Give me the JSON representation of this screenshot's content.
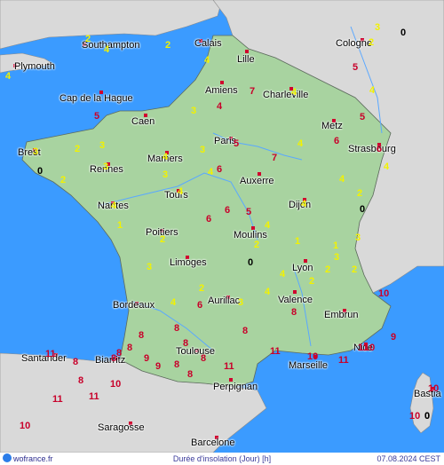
{
  "footer": {
    "brand": "wofrance.fr",
    "title": "Durée d'insolation (Jour) [h]",
    "date": "07.08.2024 CEST"
  },
  "cities": [
    {
      "name": "Southampton"
    },
    {
      "name": "Calais"
    },
    {
      "name": "Cologne"
    },
    {
      "name": "Plymouth"
    },
    {
      "name": "Lille"
    },
    {
      "name": "Cap de la Hague"
    },
    {
      "name": "Amiens"
    },
    {
      "name": "Charleville"
    },
    {
      "name": "Caen"
    },
    {
      "name": "Metz"
    },
    {
      "name": "Brest"
    },
    {
      "name": "Paris"
    },
    {
      "name": "Strasbourg"
    },
    {
      "name": "Mamers"
    },
    {
      "name": "Rennes"
    },
    {
      "name": "Auxerre"
    },
    {
      "name": "Tours"
    },
    {
      "name": "Nantes"
    },
    {
      "name": "Dijon"
    },
    {
      "name": "Poitiers"
    },
    {
      "name": "Moulins"
    },
    {
      "name": "Limoges"
    },
    {
      "name": "Lyon"
    },
    {
      "name": "Aurillac"
    },
    {
      "name": "Bordeaux"
    },
    {
      "name": "Valence"
    },
    {
      "name": "Embrun"
    },
    {
      "name": "Toulouse"
    },
    {
      "name": "Santander"
    },
    {
      "name": "Biarritz"
    },
    {
      "name": "Nice"
    },
    {
      "name": "Marseille"
    },
    {
      "name": "Perpignan"
    },
    {
      "name": "Bastia"
    },
    {
      "name": "Saragosse"
    },
    {
      "name": "Barcelone"
    }
  ],
  "values": [
    {
      "v": "2"
    },
    {
      "v": "4"
    },
    {
      "v": "2"
    },
    {
      "v": "4"
    },
    {
      "v": "4"
    },
    {
      "v": "0"
    },
    {
      "v": "2"
    },
    {
      "v": "7"
    },
    {
      "v": "4"
    },
    {
      "v": "3"
    },
    {
      "v": "4"
    },
    {
      "v": "5"
    },
    {
      "v": "4"
    },
    {
      "v": "5"
    },
    {
      "v": "5"
    },
    {
      "v": "6"
    },
    {
      "v": "3"
    },
    {
      "v": "3"
    },
    {
      "v": "5"
    },
    {
      "v": "4"
    },
    {
      "v": "6"
    },
    {
      "v": "4"
    },
    {
      "v": "0"
    },
    {
      "v": "3"
    },
    {
      "v": "2"
    },
    {
      "v": "3"
    },
    {
      "v": "7"
    },
    {
      "v": "6"
    },
    {
      "v": "2"
    },
    {
      "v": "3"
    },
    {
      "v": "4"
    },
    {
      "v": "3"
    },
    {
      "v": "4"
    },
    {
      "v": "4"
    },
    {
      "v": "4"
    },
    {
      "v": "2"
    },
    {
      "v": "4"
    },
    {
      "v": "4"
    },
    {
      "v": "0"
    },
    {
      "v": "1"
    },
    {
      "v": "6"
    },
    {
      "v": "6"
    },
    {
      "v": "5"
    },
    {
      "v": "4"
    },
    {
      "v": "2"
    },
    {
      "v": "2"
    },
    {
      "v": "3"
    },
    {
      "v": "1"
    },
    {
      "v": "1"
    },
    {
      "v": "3"
    },
    {
      "v": "3"
    },
    {
      "v": "0"
    },
    {
      "v": "2"
    },
    {
      "v": "2"
    },
    {
      "v": "2"
    },
    {
      "v": "2"
    },
    {
      "v": "4"
    },
    {
      "v": "6"
    },
    {
      "v": "4"
    },
    {
      "v": "4"
    },
    {
      "v": "3"
    },
    {
      "v": "10"
    },
    {
      "v": "8"
    },
    {
      "v": "8"
    },
    {
      "v": "8"
    },
    {
      "v": "8"
    },
    {
      "v": "8"
    },
    {
      "v": "8"
    },
    {
      "v": "8"
    },
    {
      "v": "9"
    },
    {
      "v": "9"
    },
    {
      "v": "8"
    },
    {
      "v": "11"
    },
    {
      "v": "8"
    },
    {
      "v": "9"
    },
    {
      "v": "11"
    },
    {
      "v": "8"
    },
    {
      "v": "8"
    },
    {
      "v": "10"
    },
    {
      "v": "11"
    },
    {
      "v": "11"
    },
    {
      "v": "8"
    },
    {
      "v": "8"
    },
    {
      "v": "10"
    },
    {
      "v": "11"
    },
    {
      "v": "11"
    },
    {
      "v": "10"
    },
    {
      "v": "10"
    },
    {
      "v": "11"
    },
    {
      "v": "10"
    },
    {
      "v": "0"
    },
    {
      "v": "10"
    },
    {
      "v": "0"
    }
  ],
  "colors": {
    "sea": "#3b9bff",
    "france": "#a8d3a0",
    "neighbors": "#d9d9d9",
    "rivers": "#5aa8ff",
    "city_marker": "#d0002e",
    "low_value": "#f2f200",
    "high_value": "#c8002a"
  }
}
